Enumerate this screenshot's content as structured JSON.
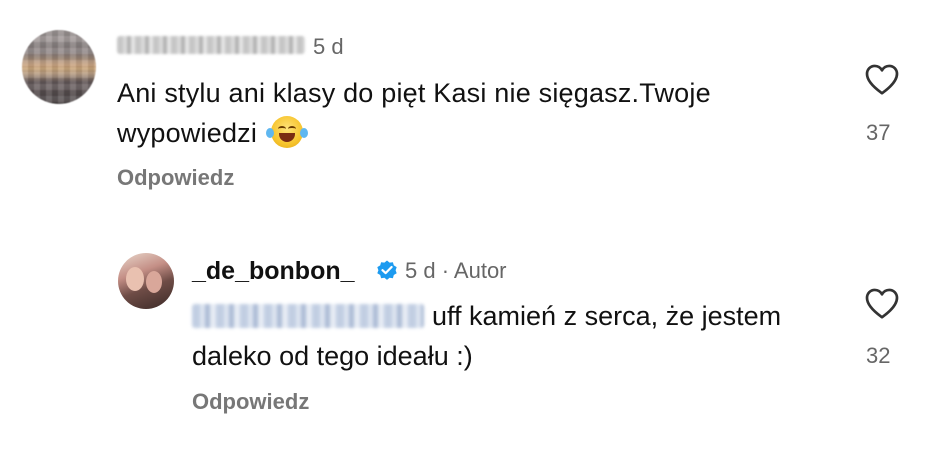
{
  "comments": [
    {
      "username": "",
      "time": "5 d",
      "text": "Ani stylu ani klasy do pięt Kasi nie sięgasz.Twoje wypowiedzi",
      "emoji": "face-with-tears-of-joy",
      "reply_label": "Odpowiedz",
      "likes": "37",
      "icon": "heart-icon"
    },
    {
      "username": "_de_bonbon_",
      "verified": true,
      "time": "5 d · Autor",
      "mention": "",
      "text": "uff kamień z serca, że jestem daleko od tego ideału :)",
      "reply_label": "Odpowiedz",
      "likes": "32",
      "icon": "heart-icon"
    }
  ],
  "colors": {
    "verified": "#1d9bf0",
    "secondary_text": "#737373"
  }
}
